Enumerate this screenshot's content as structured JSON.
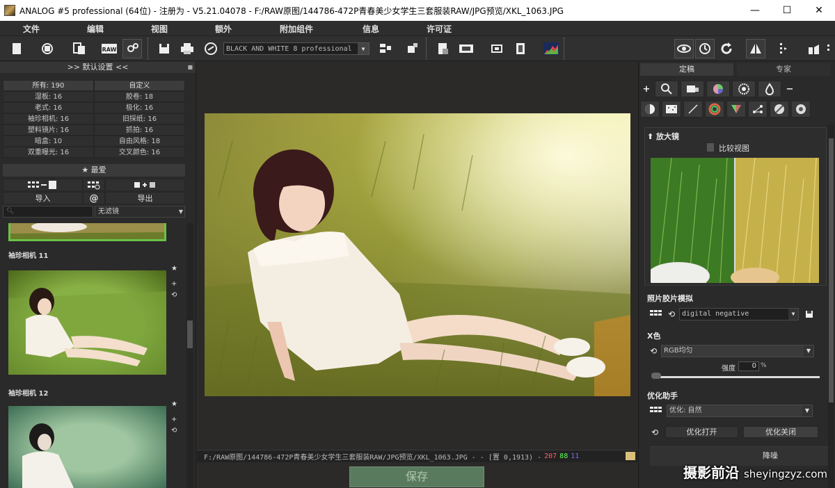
{
  "window": {
    "title": "ANALOG #5 professional (64位) - 注册为 - V5.21.04078 - F:/RAW原图/144786-472P青春美少女学生三套服装RAW/JPG预览/XKL_1063.JPG",
    "minimize": "—",
    "maximize": "☐",
    "close": "✕"
  },
  "menu": [
    "文件",
    "编辑",
    "视图",
    "额外",
    "附加组件",
    "信息",
    "许可证"
  ],
  "toolbar": {
    "preset": "BLACK AND WHITE 8 professional",
    "raw_label": "RAW"
  },
  "left_panel": {
    "header": ">> 默认设置 <<",
    "tabs": [
      "所有: 190",
      "自定义"
    ],
    "categories": [
      [
        "湿板: 16",
        "胶卷: 18"
      ],
      [
        "老式: 16",
        "极化: 16"
      ],
      [
        "袖珍相机: 16",
        "旧採纸: 16"
      ],
      [
        "塑料镜片: 16",
        "抓拍: 16"
      ],
      [
        "暗盒: 10",
        "自由风格: 18"
      ],
      [
        "双重曝光: 16",
        "交叉颜色: 16"
      ]
    ],
    "favorites": "★ 最爱",
    "import_label": "导入",
    "at_symbol": "@",
    "export_label": "导出",
    "filter_select": "无滤镜",
    "thumbs": [
      {
        "label": "袖珍相机  11"
      },
      {
        "label": "袖珍相机  12"
      }
    ]
  },
  "center": {
    "status_path": "F:/RAW原图/144786-472P青春美少女学生三套服装RAW/JPG预览/XKL_1063.JPG -   - [置 0,1913) -",
    "r": "207",
    "g": "88",
    "b": "11",
    "swatch_color": "#d8c07a",
    "save_label": "保存"
  },
  "right_panel": {
    "tabs": [
      "定稿",
      "专家"
    ],
    "loupe_title": "⬆ 放大镜",
    "compare_label": "比较视图",
    "film_title": "照片胶片模拟",
    "film_value": "digital negative",
    "x_color_title": "X色",
    "x_color_value": "RGB均匀",
    "strength_label": "强度",
    "strength_value": "0",
    "strength_unit": "%",
    "opt_title": "优化助手",
    "opt_value": "优化: 自然",
    "opt_on": "优化打开",
    "opt_off": "优化关闭",
    "noise_label": "降噪"
  },
  "watermark": {
    "cn": "摄影前沿",
    "url": "sheyingzyz.com"
  }
}
